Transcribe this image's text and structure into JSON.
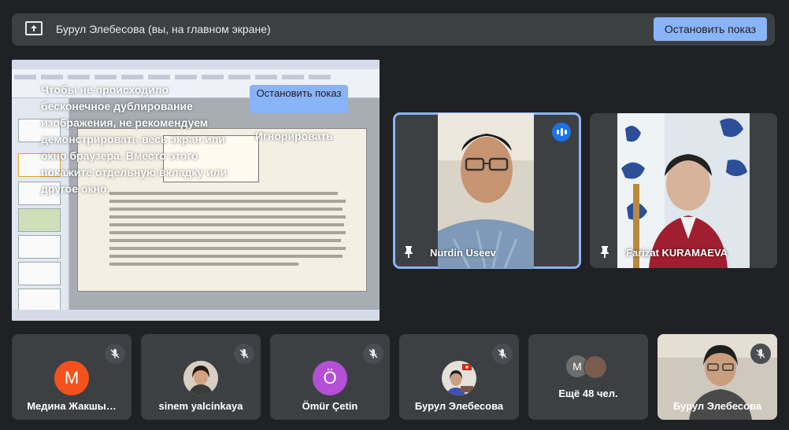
{
  "banner": {
    "title": "Бурул Элебесова (вы, на главном экране)",
    "stop_label": "Остановить показ",
    "icon": "present-screen-icon"
  },
  "presentation": {
    "warning_text": "Чтобы не происходило бесконечное дублирование изображения, не рекомендуем демонстрировать весь экран или окно браузера. Вместо этого покажите отдельную вкладку или другое окно.",
    "stop_label": "Остановить показ",
    "ignore_label": "Игнорировать"
  },
  "video_tiles": [
    {
      "name": "Nurdin Useev",
      "speaking": true,
      "pinned_icon": "pin-icon"
    },
    {
      "name": "Farizat KURAMAEVA",
      "speaking": false,
      "pinned_icon": "pin-icon"
    }
  ],
  "participants": [
    {
      "name": "Медина Жакшы…",
      "avatar_letter": "M",
      "avatar_color": "#f4511e",
      "muted": true
    },
    {
      "name": "sinem yalcinkaya",
      "avatar_letter": "",
      "avatar_color": "#8d6e63",
      "muted": true
    },
    {
      "name": "Ömür Çetin",
      "avatar_letter": "Ö",
      "avatar_color": "#b44fd6",
      "muted": true
    },
    {
      "name": "Бурул Элебесова",
      "avatar_letter": "",
      "avatar_color": "#90a4ae",
      "muted": true
    },
    {
      "name": "Ещё 48 чел.",
      "avatar_letter": "M",
      "avatar_color": "#6d6d6d",
      "muted": false
    },
    {
      "name": "Бурул Элебесова",
      "avatar_letter": "",
      "avatar_color": "#8c8c8c",
      "muted": true
    }
  ],
  "colors": {
    "background": "#202124",
    "tile": "#3c4043",
    "accent": "#8ab4f8",
    "speaking": "#1a73e8"
  }
}
